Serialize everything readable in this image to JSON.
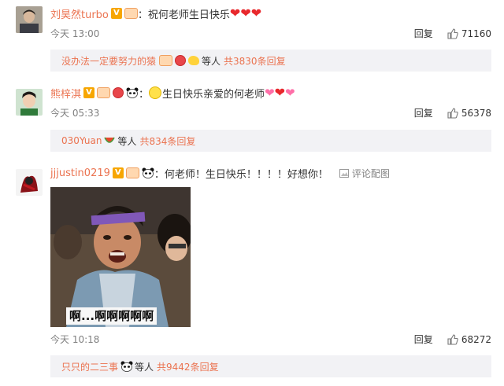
{
  "comments": [
    {
      "username": "刘昊然turbo",
      "text": "祝何老师生日快乐",
      "time": "今天 13:00",
      "reply_label": "回复",
      "likes": "71160",
      "sub_user": "没办法一定要努力的猿",
      "sub_suffix": "等人",
      "sub_count": "共3830条回复"
    },
    {
      "username": "熊梓淇",
      "text": "生日快乐亲爱的何老师",
      "time": "今天 05:33",
      "reply_label": "回复",
      "likes": "56378",
      "sub_user": "030Yuan",
      "sub_suffix": "等人",
      "sub_count": "共834条回复"
    },
    {
      "username": "jjjustin0219",
      "text": "何老师！生日快乐！！！！好想你！",
      "comment_pic_label": "评论配图",
      "image_caption": "啊...啊啊啊啊啊",
      "time": "今天 10:18",
      "reply_label": "回复",
      "likes": "68272",
      "sub_user": "只只的二三事",
      "sub_suffix": "等人",
      "sub_count": "共9442条回复"
    }
  ],
  "colors": {
    "username": "#eb7350",
    "meta": "#808080",
    "subbox_bg": "#f2f2f5"
  }
}
